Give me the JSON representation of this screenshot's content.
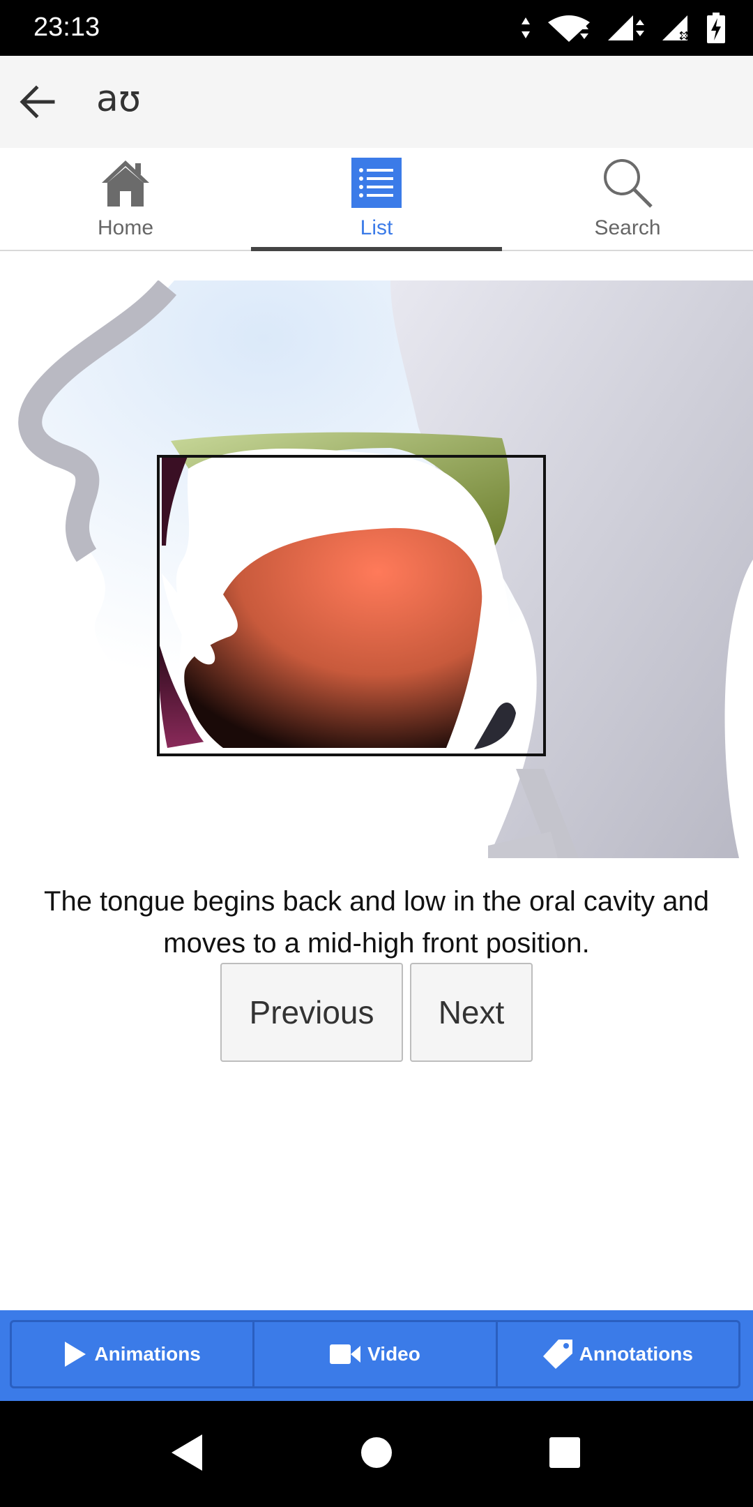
{
  "status_bar": {
    "time": "23:13",
    "icons": [
      "data-arrows-icon",
      "wifi-icon",
      "signal-icon",
      "signal-no-sim-icon",
      "battery-charging-icon"
    ]
  },
  "app_bar": {
    "title": "aʊ",
    "back_icon": "arrow-left-icon"
  },
  "tabs": [
    {
      "label": "Home",
      "icon": "home-icon",
      "active": false
    },
    {
      "label": "List",
      "icon": "list-icon",
      "active": true
    },
    {
      "label": "Search",
      "icon": "search-icon",
      "active": false
    }
  ],
  "illustration": {
    "subject": "sagittal view of mouth with tongue highlighted"
  },
  "description": "The tongue begins back and low in the oral cavity and moves to a mid-high front position.",
  "buttons": {
    "previous": "Previous",
    "next": "Next"
  },
  "bottom_bar": [
    {
      "label": "Animations",
      "icon": "play-icon"
    },
    {
      "label": "Video",
      "icon": "video-camera-icon"
    },
    {
      "label": "Annotations",
      "icon": "tag-icon"
    }
  ],
  "colors": {
    "accent": "#3b7be8",
    "tongue": "#ff7a5a"
  }
}
